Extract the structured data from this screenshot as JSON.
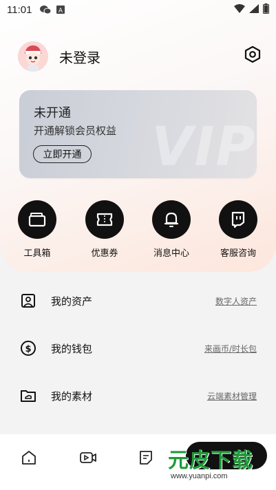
{
  "status_bar": {
    "time": "11:01",
    "icons": [
      "wechat-icon",
      "a-badge-icon",
      "wifi-icon",
      "signal-icon",
      "battery-icon"
    ]
  },
  "profile": {
    "name": "未登录"
  },
  "vip_card": {
    "title": "未开通",
    "subtitle": "开通解锁会员权益",
    "button": "立即开通",
    "watermark": "VIP"
  },
  "quick_actions": [
    {
      "label": "工具箱",
      "icon": "toolbox-icon"
    },
    {
      "label": "优惠券",
      "icon": "coupon-icon"
    },
    {
      "label": "消息中心",
      "icon": "bell-icon"
    },
    {
      "label": "客服咨询",
      "icon": "chat-support-icon"
    }
  ],
  "menu": [
    {
      "label": "我的资产",
      "link": "数字人资产",
      "icon": "portrait-frame-icon"
    },
    {
      "label": "我的钱包",
      "link": "来画币/时长包",
      "icon": "coin-icon"
    },
    {
      "label": "我的素材",
      "link": "云端素材管理",
      "icon": "cloud-folder-icon"
    }
  ],
  "bottom_nav": [
    {
      "name": "home",
      "icon": "home-icon"
    },
    {
      "name": "video",
      "icon": "video-icon"
    },
    {
      "name": "notes",
      "icon": "note-icon"
    }
  ],
  "watermark": {
    "main": "元皮下载",
    "url": "www.yuanpi.com"
  }
}
